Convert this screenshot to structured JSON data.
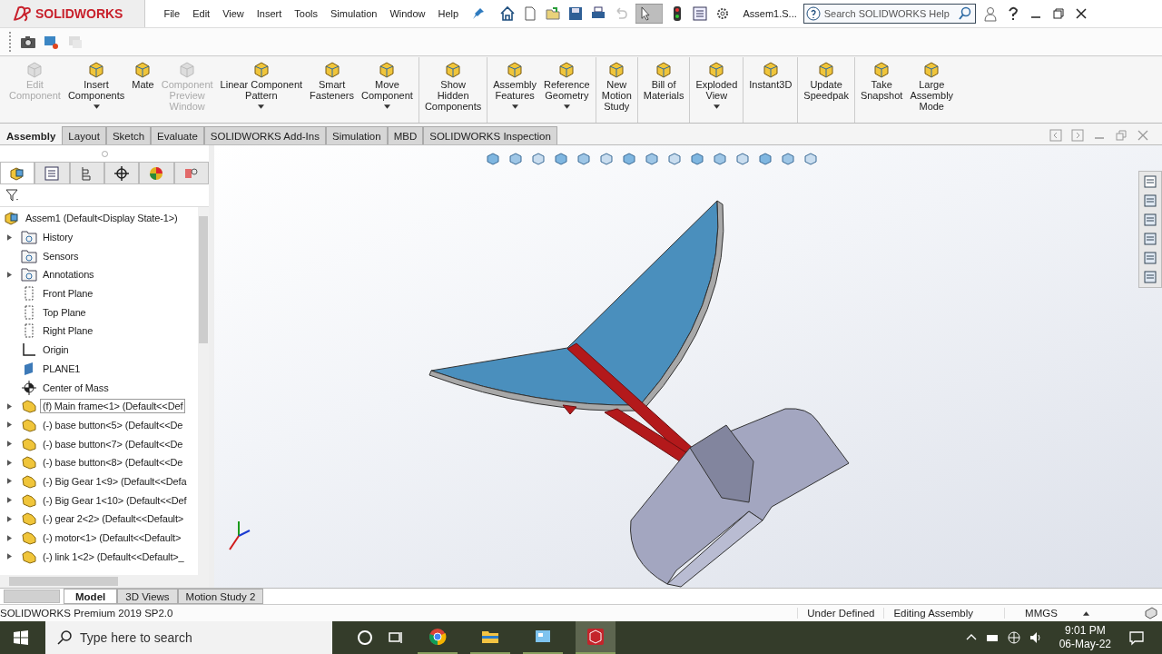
{
  "app": {
    "logo": "SOLIDWORKS",
    "menu": [
      "File",
      "Edit",
      "View",
      "Insert",
      "Tools",
      "Simulation",
      "Window",
      "Help"
    ],
    "document_title": "Assem1.S...",
    "search": {
      "placeholder": "Search SOLIDWORKS Help"
    }
  },
  "ribbon": {
    "groups": [
      {
        "buttons": [
          {
            "label": "Edit\nComponent",
            "disabled": true,
            "dropdown": false
          },
          {
            "label": "Insert\nComponents",
            "disabled": false,
            "dropdown": true
          },
          {
            "label": "Mate",
            "disabled": false,
            "dropdown": false
          },
          {
            "label": "Component\nPreview\nWindow",
            "disabled": true,
            "dropdown": false
          },
          {
            "label": "Linear Component\nPattern",
            "disabled": false,
            "dropdown": true
          },
          {
            "label": "Smart\nFasteners",
            "disabled": false,
            "dropdown": false
          },
          {
            "label": "Move\nComponent",
            "disabled": false,
            "dropdown": true
          }
        ]
      },
      {
        "buttons": [
          {
            "label": "Show\nHidden\nComponents",
            "disabled": false,
            "dropdown": false
          }
        ]
      },
      {
        "buttons": [
          {
            "label": "Assembly\nFeatures",
            "disabled": false,
            "dropdown": true
          },
          {
            "label": "Reference\nGeometry",
            "disabled": false,
            "dropdown": true
          }
        ]
      },
      {
        "buttons": [
          {
            "label": "New\nMotion\nStudy",
            "disabled": false,
            "dropdown": false
          }
        ]
      },
      {
        "buttons": [
          {
            "label": "Bill of\nMaterials",
            "disabled": false,
            "dropdown": false
          }
        ]
      },
      {
        "buttons": [
          {
            "label": "Exploded\nView",
            "disabled": false,
            "dropdown": true
          }
        ]
      },
      {
        "buttons": [
          {
            "label": "Instant3D",
            "disabled": false,
            "dropdown": false
          }
        ]
      },
      {
        "buttons": [
          {
            "label": "Update\nSpeedpak",
            "disabled": false,
            "dropdown": false
          }
        ]
      },
      {
        "buttons": [
          {
            "label": "Take\nSnapshot",
            "disabled": false,
            "dropdown": false
          },
          {
            "label": "Large\nAssembly\nMode",
            "disabled": false,
            "dropdown": false
          }
        ]
      }
    ]
  },
  "command_tabs": [
    {
      "label": "Assembly",
      "selected": true
    },
    {
      "label": "Layout",
      "selected": false
    },
    {
      "label": "Sketch",
      "selected": false
    },
    {
      "label": "Evaluate",
      "selected": false
    },
    {
      "label": "SOLIDWORKS Add-Ins",
      "selected": false
    },
    {
      "label": "Simulation",
      "selected": false
    },
    {
      "label": "MBD",
      "selected": false
    },
    {
      "label": "SOLIDWORKS Inspection",
      "selected": false
    }
  ],
  "feature_tree": {
    "root": {
      "label": "Assem1  (Default<Display State-1>)",
      "children": [
        {
          "label": "History",
          "kind": "folder",
          "expandable": true,
          "selected": false
        },
        {
          "label": "Sensors",
          "kind": "folder",
          "expandable": false,
          "selected": false
        },
        {
          "label": "Annotations",
          "kind": "folder",
          "expandable": true,
          "selected": false
        },
        {
          "label": "Front Plane",
          "kind": "plane",
          "expandable": false,
          "selected": false
        },
        {
          "label": "Top Plane",
          "kind": "plane",
          "expandable": false,
          "selected": false
        },
        {
          "label": "Right Plane",
          "kind": "plane",
          "expandable": false,
          "selected": false
        },
        {
          "label": "Origin",
          "kind": "origin",
          "expandable": false,
          "selected": false
        },
        {
          "label": "PLANE1",
          "kind": "surface",
          "expandable": false,
          "selected": false
        },
        {
          "label": "Center of Mass",
          "kind": "mass",
          "expandable": false,
          "selected": false
        },
        {
          "label": "(f) Main frame<1> (Default<<Def",
          "kind": "part",
          "expandable": true,
          "selected": true
        },
        {
          "label": "(-) base button<5> (Default<<De",
          "kind": "part",
          "expandable": true,
          "selected": false
        },
        {
          "label": "(-) base button<7> (Default<<De",
          "kind": "part",
          "expandable": true,
          "selected": false
        },
        {
          "label": "(-) base button<8> (Default<<De",
          "kind": "part",
          "expandable": true,
          "selected": false
        },
        {
          "label": "(-) Big Gear 1<9> (Default<<Defa",
          "kind": "part",
          "expandable": true,
          "selected": false
        },
        {
          "label": "(-) Big Gear 1<10> (Default<<Def",
          "kind": "part",
          "expandable": true,
          "selected": false
        },
        {
          "label": "(-) gear 2<2> (Default<<Default>",
          "kind": "part",
          "expandable": true,
          "selected": false
        },
        {
          "label": "(-) motor<1> (Default<<Default>",
          "kind": "part",
          "expandable": true,
          "selected": false
        },
        {
          "label": "(-) link 1<2> (Default<<Default>_",
          "kind": "part",
          "expandable": true,
          "selected": false
        }
      ]
    }
  },
  "bottom_tabs": [
    {
      "label": "Model",
      "selected": true
    },
    {
      "label": "3D Views",
      "selected": false
    },
    {
      "label": "Motion Study 2",
      "selected": false
    }
  ],
  "status_bar": {
    "product": "SOLIDWORKS Premium 2019 SP2.0",
    "state": "Under Defined",
    "mode": "Editing Assembly",
    "units": "MMGS"
  },
  "taskbar": {
    "search": {
      "placeholder": "Type here to search"
    },
    "apps": [
      {
        "selected": false
      },
      {
        "selected": false
      },
      {
        "selected": false
      },
      {
        "selected": true
      }
    ],
    "time": "9:01 PM",
    "date": "06-May-22"
  }
}
